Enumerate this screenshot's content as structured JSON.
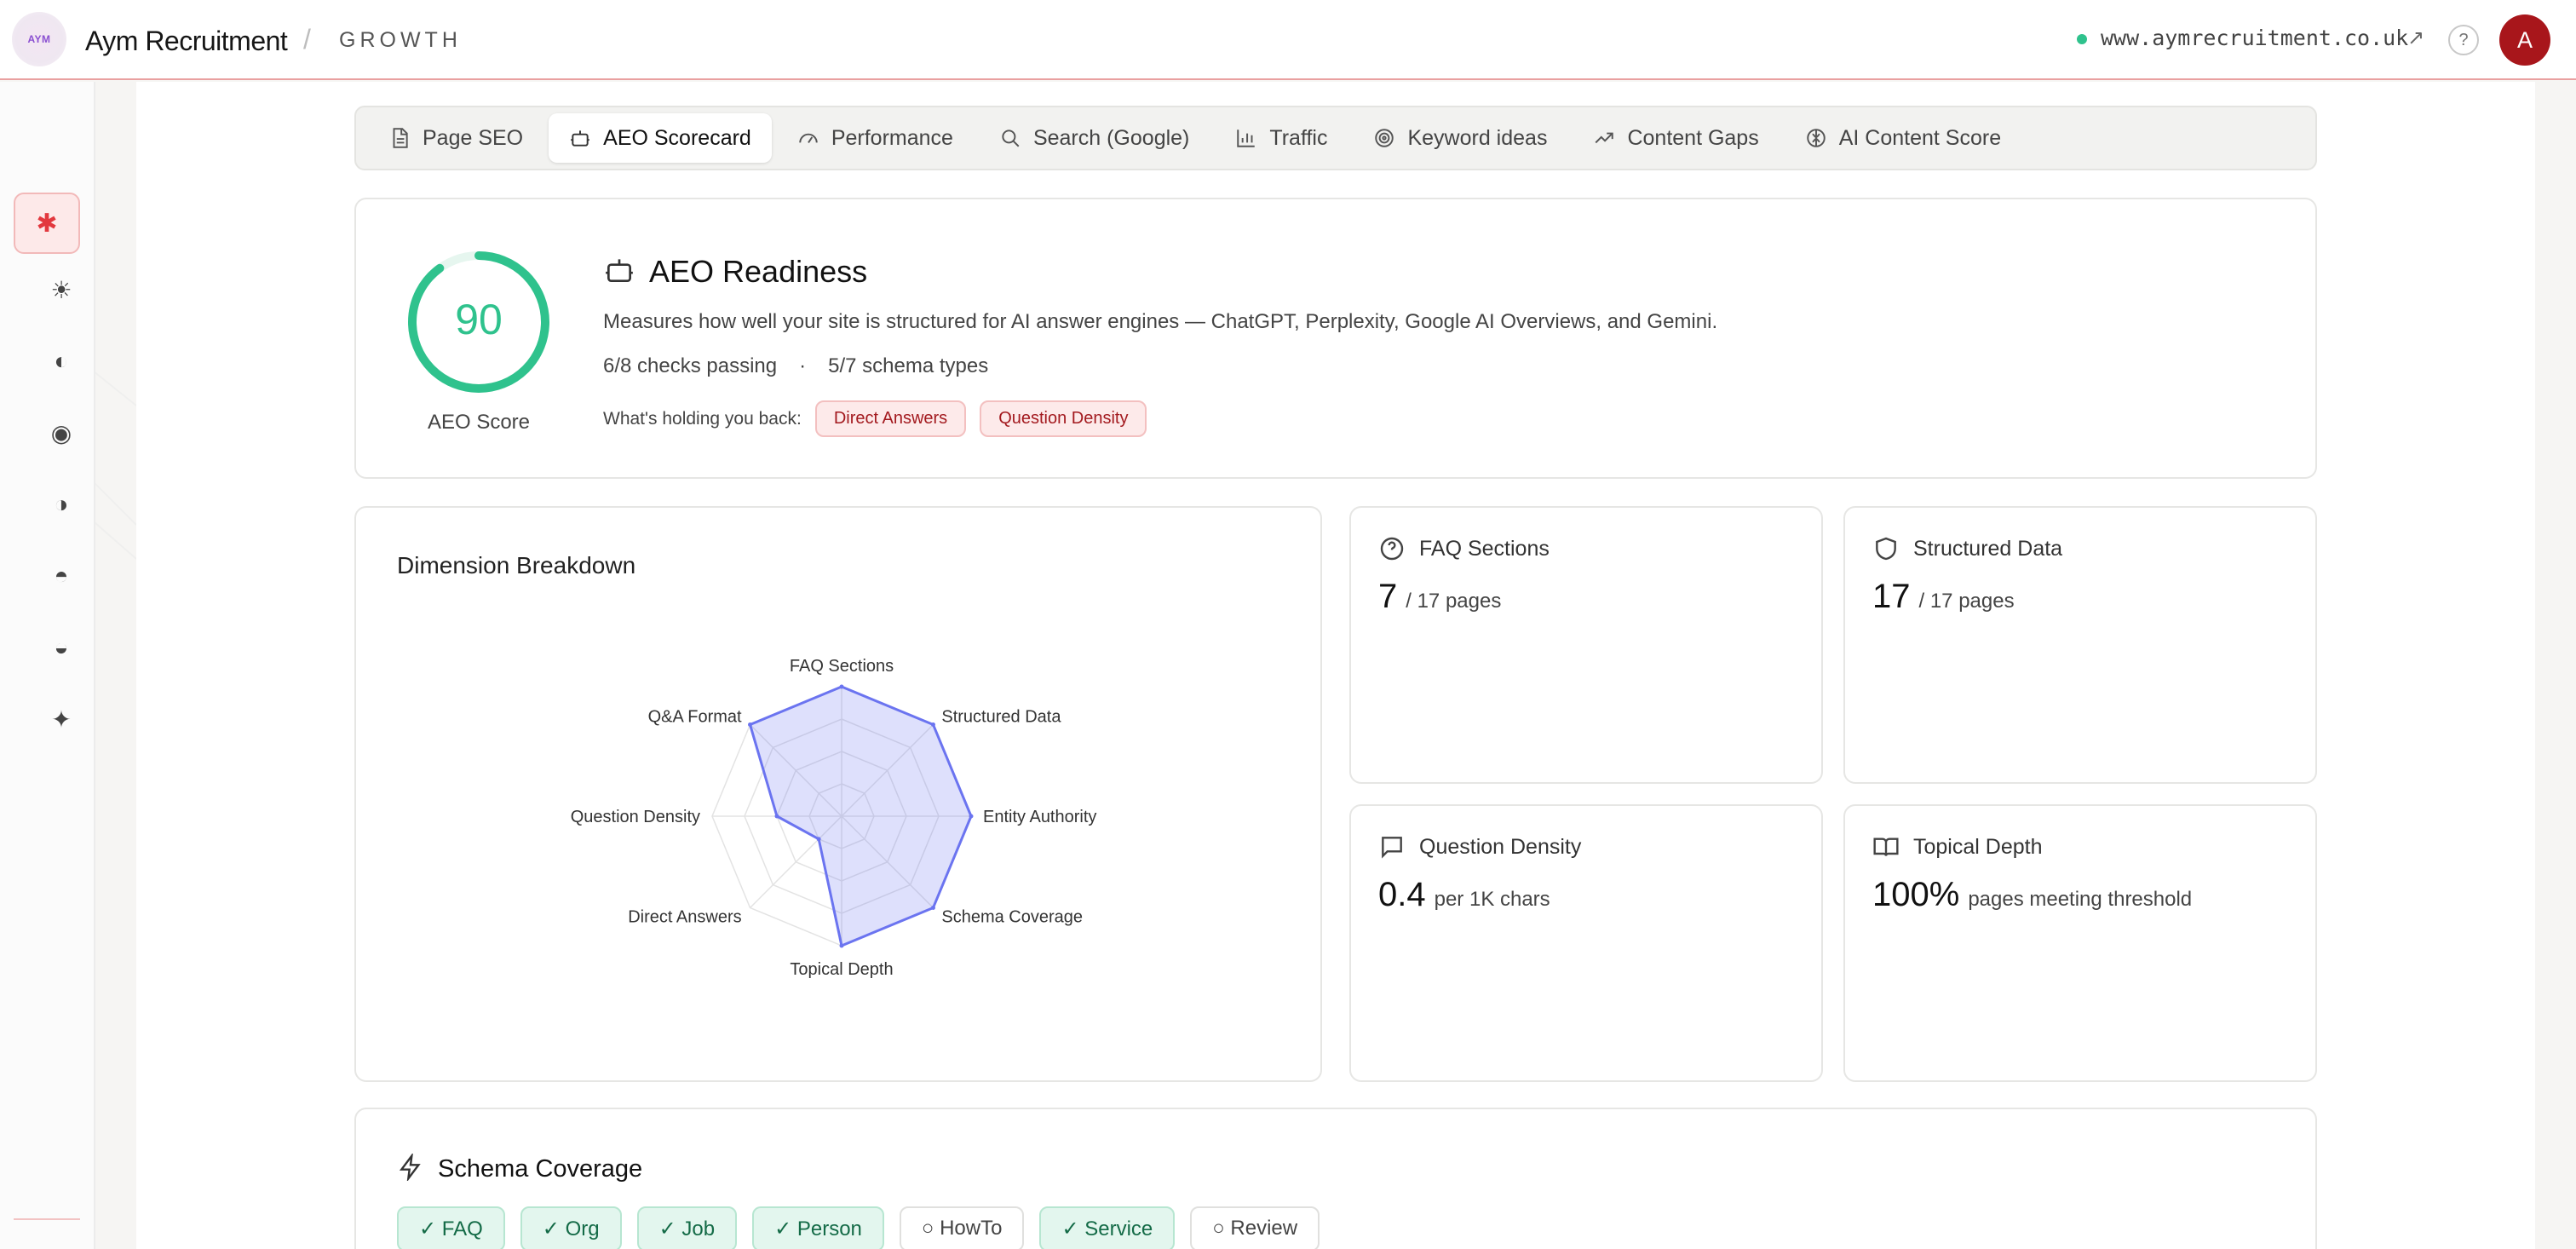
{
  "header": {
    "logo_text": "AYM",
    "brand": "Aym Recruitment",
    "separator": "/",
    "section": "GROWTH",
    "site_url": "www.aymrecruitment.co.uk",
    "help": "?",
    "avatar_initial": "A",
    "colors": {
      "accent": "#a8161b",
      "status_dot": "#2fc28d",
      "divider": "#e9a0a0"
    }
  },
  "rail": {
    "active_icon": "asterisk-icon",
    "icons": [
      "sun-icon",
      "half-moon-icon",
      "target-icon",
      "contrast-icon",
      "half-circle-top-icon",
      "half-circle-bottom-icon",
      "sparkle-icon"
    ],
    "collapse_label": "←"
  },
  "tabs": [
    {
      "label": "Page SEO",
      "icon": "document-icon",
      "active": false
    },
    {
      "label": "AEO Scorecard",
      "icon": "robot-icon",
      "active": true
    },
    {
      "label": "Performance",
      "icon": "gauge-icon",
      "active": false
    },
    {
      "label": "Search (Google)",
      "icon": "search-icon",
      "active": false
    },
    {
      "label": "Traffic",
      "icon": "bar-chart-icon",
      "active": false
    },
    {
      "label": "Keyword ideas",
      "icon": "target-icon",
      "active": false
    },
    {
      "label": "Content Gaps",
      "icon": "trending-up-icon",
      "active": false
    },
    {
      "label": "AI Content Score",
      "icon": "brain-icon",
      "active": false
    }
  ],
  "readiness": {
    "score": "90",
    "score_value": 90,
    "score_label": "AEO Score",
    "title": "AEO Readiness",
    "description": "Measures how well your site is structured for AI answer engines — ChatGPT, Perplexity, Google AI Overviews, and Gemini.",
    "checks": "6/8 checks passing",
    "dot": "·",
    "schema_types": "5/7 schema types",
    "holding_label": "What's holding you back:",
    "holding_items": [
      "Direct Answers",
      "Question Density"
    ],
    "colors": {
      "score": "#2fc28d",
      "chip_text": "#a31a1f"
    }
  },
  "dimension": {
    "title": "Dimension Breakdown"
  },
  "chart_data": {
    "type": "radar",
    "title": "Dimension Breakdown",
    "categories": [
      "FAQ Sections",
      "Structured Data",
      "Entity Authority",
      "Schema Coverage",
      "Topical Depth",
      "Direct Answers",
      "Question Density",
      "Q&A Format"
    ],
    "values": [
      100,
      100,
      100,
      100,
      100,
      25,
      50,
      100
    ],
    "ylim": [
      0,
      100
    ],
    "grid_levels": 4,
    "grid": true,
    "color": "#6b74f0"
  },
  "metrics": [
    {
      "title": "FAQ Sections",
      "icon": "help-circle-icon",
      "value": "7",
      "unit": "/ 17 pages"
    },
    {
      "title": "Structured Data",
      "icon": "shield-icon",
      "value": "17",
      "unit": "/ 17 pages"
    },
    {
      "title": "Question Density",
      "icon": "chat-bubble-icon",
      "value": "0.4",
      "unit": "per 1K chars"
    },
    {
      "title": "Topical Depth",
      "icon": "book-icon",
      "value": "100%",
      "unit": "pages meeting threshold"
    }
  ],
  "schema": {
    "title": "Schema Coverage",
    "icon": "lightning-icon",
    "items": [
      {
        "label": "✓ FAQ",
        "ok": true
      },
      {
        "label": "✓ Org",
        "ok": true
      },
      {
        "label": "✓ Job",
        "ok": true
      },
      {
        "label": "✓ Person",
        "ok": true
      },
      {
        "label": "○ HowTo",
        "ok": false
      },
      {
        "label": "✓ Service",
        "ok": true
      },
      {
        "label": "○ Review",
        "ok": false
      }
    ]
  }
}
